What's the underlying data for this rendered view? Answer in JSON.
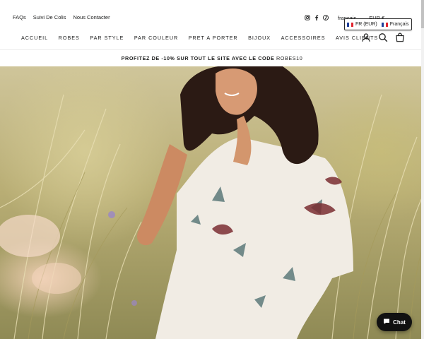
{
  "utility_links": [
    {
      "label": "FAQs"
    },
    {
      "label": "Suivi De Colis"
    },
    {
      "label": "Nous Contacter"
    }
  ],
  "social_icons": [
    "instagram-icon",
    "facebook-icon",
    "pinterest-icon"
  ],
  "locale_hint": {
    "language": "français",
    "currency": "EUR €"
  },
  "locale_selector": {
    "currency": "FR (EUR)",
    "language": "Français"
  },
  "nav": {
    "items": [
      {
        "label": "ACCUEIL"
      },
      {
        "label": "ROBES"
      },
      {
        "label": "PAR STYLE"
      },
      {
        "label": "PAR COULEUR"
      },
      {
        "label": "PRET A PORTER"
      },
      {
        "label": "BIJOUX"
      },
      {
        "label": "ACCESSOIRES"
      },
      {
        "label": "AVIS CLIENTS"
      }
    ],
    "icons": [
      "account-icon",
      "search-icon",
      "cart-icon"
    ]
  },
  "promo": {
    "text": "PROFITEZ DE -10% SUR TOUT LE SITE AVEC LE CODE ",
    "code": "ROBES10"
  },
  "chat": {
    "label": "Chat"
  },
  "colors": {
    "text": "#1c1d1d",
    "chat_bg": "#111111",
    "flag_blue": "#1f3f9a",
    "flag_red": "#e1252f"
  }
}
